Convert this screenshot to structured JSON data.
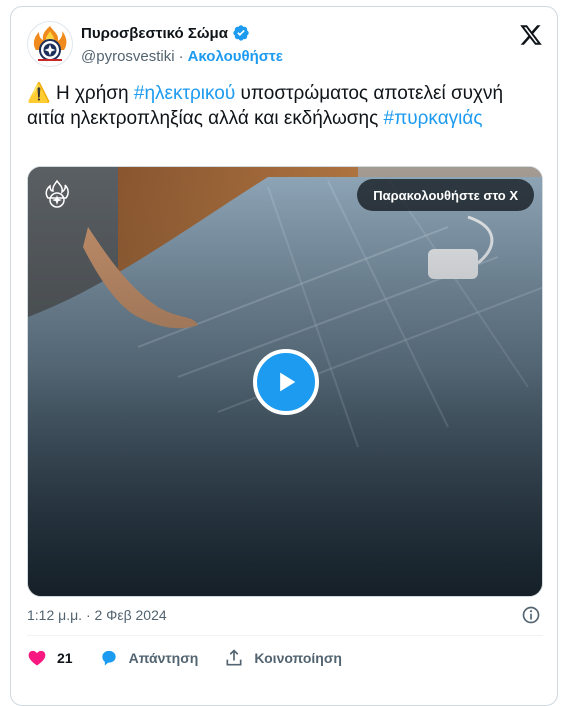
{
  "account": {
    "display_name": "Πυροσβεστικό Σώμα",
    "handle": "@pyrosvestiki",
    "separator": "·",
    "follow_label": "Ακολουθήστε"
  },
  "tweet": {
    "warning_emoji": "⚠️",
    "text_1": " Η χρήση ",
    "hashtag_1": "#ηλεκτρικού",
    "text_2": " υποστρώματος αποτελεί συχνή αιτία ηλεκτροπληξίας αλλά και εκδήλωσης ",
    "hashtag_2": "#πυρκαγιάς"
  },
  "media": {
    "watch_label": "Παρακολουθήστε στο X"
  },
  "meta": {
    "timestamp": "1:12 μ.μ. · 2 Φεβ 2024"
  },
  "actions": {
    "like_count": "21",
    "reply_label": "Απάντηση",
    "share_label": "Κοινοποίηση"
  },
  "colors": {
    "accent": "#1d9bf0",
    "like": "#f91880",
    "muted": "#536471"
  }
}
